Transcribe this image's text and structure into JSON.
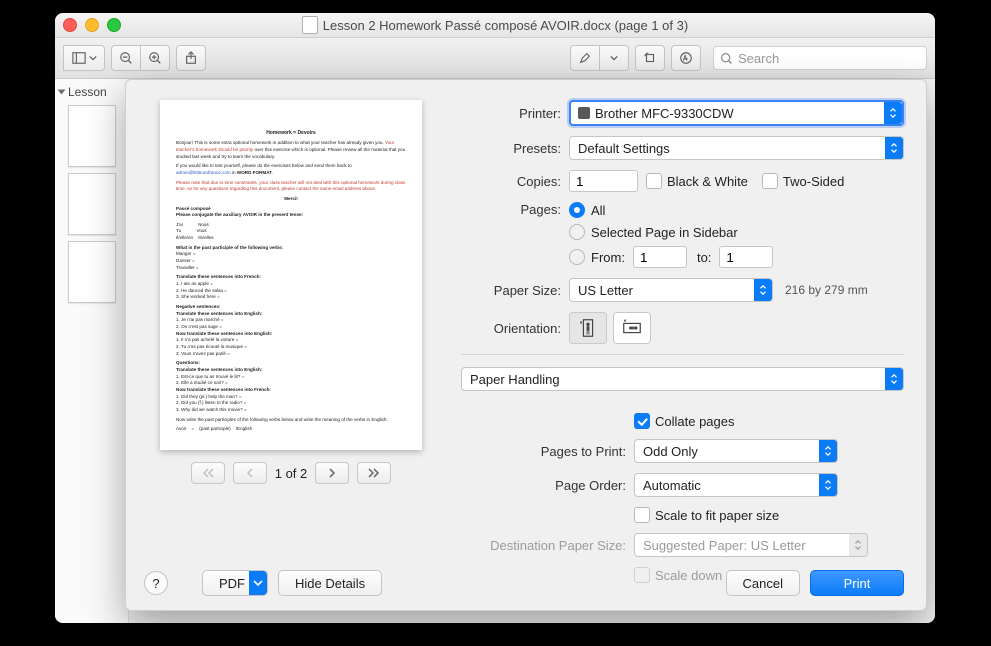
{
  "window": {
    "title": "Lesson 2 Homework Passé composé AVOIR.docx (page 1 of 3)",
    "sidebar_label": "Lesson"
  },
  "toolbar": {
    "search_placeholder": "Search"
  },
  "preview": {
    "page_indicator": "1 of 2"
  },
  "dialog": {
    "labels": {
      "printer": "Printer:",
      "presets": "Presets:",
      "copies": "Copies:",
      "pages": "Pages:",
      "paper_size": "Paper Size:",
      "orientation": "Orientation:",
      "pages_to_print": "Pages to Print:",
      "page_order": "Page Order:",
      "dest_paper": "Destination Paper Size:"
    },
    "printer": "Brother MFC-9330CDW",
    "presets": "Default Settings",
    "copies": "1",
    "black_white": "Black & White",
    "two_sided": "Two-Sided",
    "pages_all": "All",
    "pages_selected": "Selected Page in Sidebar",
    "pages_from": "From:",
    "pages_from_val": "1",
    "pages_to": "to:",
    "pages_to_val": "1",
    "paper_size": "US Letter",
    "paper_dim": "216 by 279 mm",
    "section": "Paper Handling",
    "collate": "Collate pages",
    "pages_to_print": "Odd Only",
    "page_order": "Automatic",
    "scale_fit": "Scale to fit paper size",
    "dest_paper": "Suggested Paper: US Letter",
    "scale_down": "Scale down only"
  },
  "buttons": {
    "help": "?",
    "pdf": "PDF",
    "hide_details": "Hide Details",
    "cancel": "Cancel",
    "print": "Print"
  }
}
